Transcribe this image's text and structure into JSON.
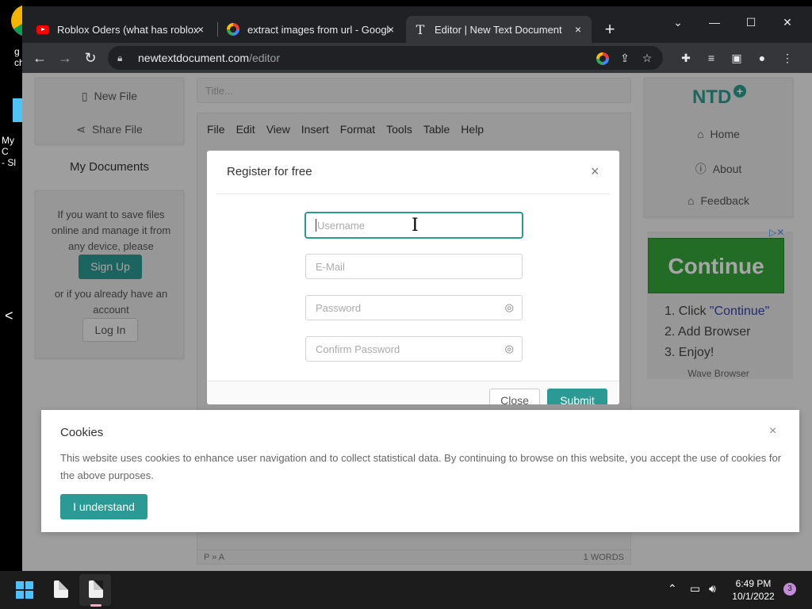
{
  "desktop": {
    "icon1_label_lines": [
      "g",
      "ch"
    ],
    "icon2_label_lines": [
      "My C",
      "- Sl"
    ],
    "side_arrow": "<"
  },
  "tabs": [
    {
      "title": "Roblox Oders (what has roblox b",
      "icon": "youtube-icon"
    },
    {
      "title": "extract images from url - Google",
      "icon": "google-icon"
    },
    {
      "title": "Editor | New Text Document",
      "icon": "document-t-icon"
    }
  ],
  "tab_close": "×",
  "new_tab": "+",
  "window_controls": {
    "dropdown": "⌄",
    "minimize": "—",
    "maximize": "☐",
    "close": "✕"
  },
  "address": {
    "host": "newtextdocument.com",
    "path": "/editor"
  },
  "sidebar_left": {
    "new_file": "New File",
    "share_file": "Share File",
    "my_documents": "My Documents",
    "info_text": "If you want to save files online and manage it from any device, please",
    "sign_up": "Sign Up",
    "or_text": "or if you already have an account",
    "log_in": "Log In"
  },
  "title_placeholder": "Title...",
  "editor": {
    "menus": [
      "File",
      "Edit",
      "View",
      "Insert",
      "Format",
      "Tools",
      "Table",
      "Help"
    ],
    "status_path": "P » A",
    "word_count": "1 WORDS"
  },
  "sidebar_right": {
    "logo_text": "NTD",
    "home": "Home",
    "about": "About",
    "feedback": "Feedback"
  },
  "ad": {
    "button": "Continue",
    "lines": [
      "1. Click ",
      "\"Continue\"",
      "2. Add Browser",
      "3. Enjoy!"
    ],
    "footer": "Wave Browser",
    "adchoices": "▷✕"
  },
  "modal": {
    "title": "Register for free",
    "close_x": "×",
    "fields": {
      "username": "Username",
      "email": "E-Mail",
      "password": "Password",
      "confirm_password": "Confirm Password"
    },
    "close_btn": "Close",
    "submit_btn": "Submit"
  },
  "cookie": {
    "title": "Cookies",
    "close_x": "×",
    "text": "This website uses cookies to enhance user navigation and to collect statistical data. By continuing to browse on this website, you accept the use of cookies for the above purposes.",
    "button": "I understand"
  },
  "taskbar": {
    "time": "6:49 PM",
    "date": "10/1/2022",
    "notifications": "3"
  },
  "colors": {
    "accent": "#2c9a94",
    "ad_green": "#35a63a"
  }
}
